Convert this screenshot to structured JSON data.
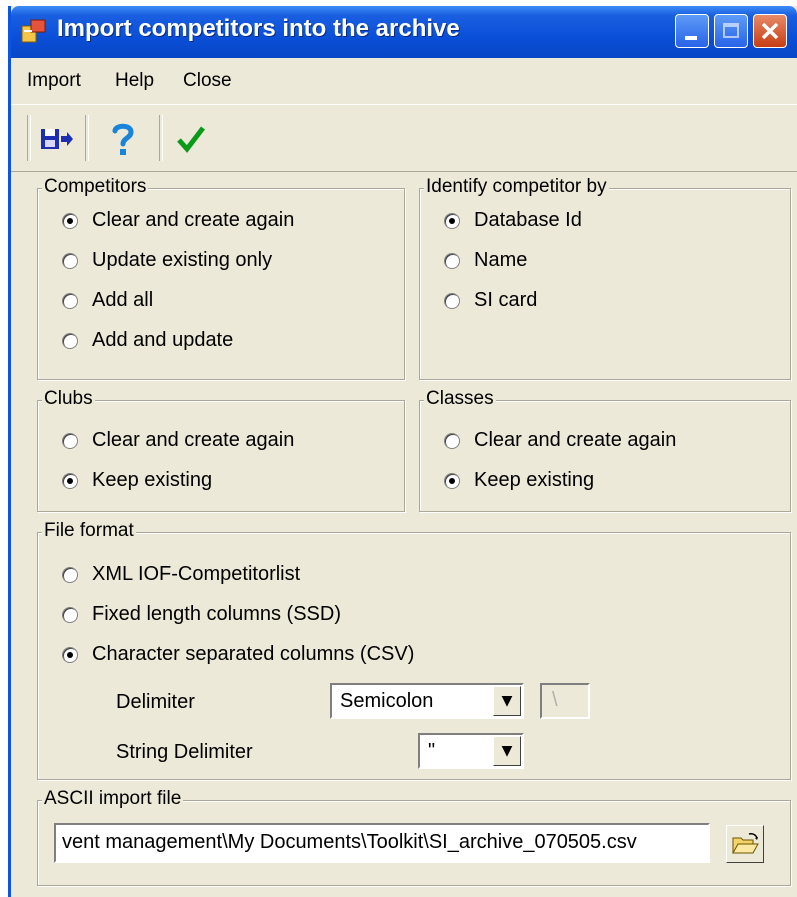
{
  "window": {
    "title": "Import competitors into the archive"
  },
  "menu": [
    "Import",
    "Help",
    "Close"
  ],
  "toolbar": {
    "icons": [
      "import-icon",
      "help-icon",
      "checkmark-icon"
    ]
  },
  "competitors": {
    "legend": "Competitors",
    "options": [
      "Clear and create again",
      "Update existing only",
      "Add all",
      "Add and update"
    ],
    "selected": "Clear and create again"
  },
  "identify": {
    "legend": "Identify competitor by",
    "options": [
      "Database Id",
      "Name",
      "SI card"
    ],
    "selected": "Database Id"
  },
  "clubs": {
    "legend": "Clubs",
    "options": [
      "Clear and create again",
      "Keep existing"
    ],
    "selected": "Keep existing"
  },
  "classes": {
    "legend": "Classes",
    "options": [
      "Clear and create again",
      "Keep existing"
    ],
    "selected": "Keep existing"
  },
  "file_format": {
    "legend": "File format",
    "options": [
      "XML IOF-Competitorlist",
      "Fixed length columns (SSD)",
      "Character separated columns (CSV)"
    ],
    "selected": "Character separated columns (CSV)",
    "delimiter_label": "Delimiter",
    "delimiter_value": "Semicolon",
    "delimiter_char": "\\",
    "string_delimiter_label": "String Delimiter",
    "string_delimiter_value": "\""
  },
  "ascii": {
    "legend": "ASCII import file",
    "path": "vent management\\My Documents\\Toolkit\\SI_archive_070505.csv"
  },
  "colors": {
    "title_bar": "#0a4fd8",
    "dialog": "#ece9d8",
    "check": "#0a9a1a"
  }
}
